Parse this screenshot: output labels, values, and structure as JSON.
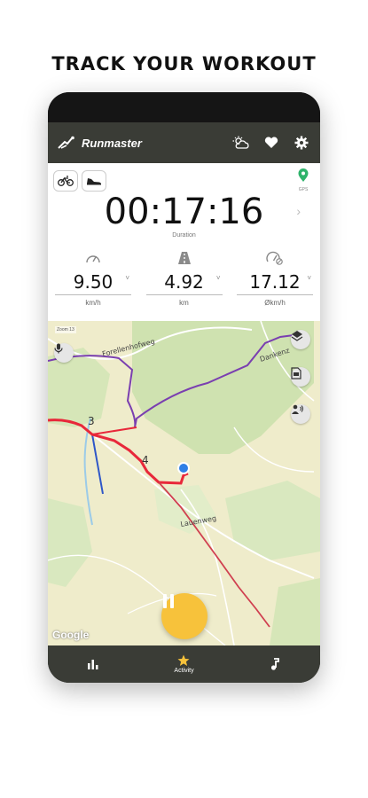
{
  "headline": "TRACK YOUR WORKOUT",
  "app": {
    "title": "Runmaster"
  },
  "appbar_icons": [
    "weather-icon",
    "heart-icon",
    "gear-icon"
  ],
  "modes": [
    "bicycle-icon",
    "shoe-icon"
  ],
  "gps_label": "GPS",
  "duration": {
    "value": "00:17:16",
    "label": "Duration"
  },
  "stats": [
    {
      "icon": "speedometer-icon",
      "value": "9.50",
      "unit": "km/h"
    },
    {
      "icon": "road-icon",
      "value": "4.92",
      "unit": "km"
    },
    {
      "icon": "average-speed-icon",
      "value": "17.12",
      "unit": "Økm/h"
    }
  ],
  "map": {
    "zoom_label": "Zoom 13",
    "street_labels": [
      "Forellenhofweg",
      "Dankenz",
      "Lauenweg"
    ],
    "waypoints": [
      "3",
      "4"
    ],
    "attribution": "Google"
  },
  "nav": [
    {
      "icon": "stats-icon",
      "label": ""
    },
    {
      "icon": "star-icon",
      "label": "Activity"
    },
    {
      "icon": "music-icon",
      "label": ""
    }
  ],
  "colors": {
    "appbar": "#3a3c36",
    "pause_button": "#f7c23b",
    "track": "#e8283a",
    "route": "#7a3fb0",
    "position": "#2f7fe6"
  }
}
